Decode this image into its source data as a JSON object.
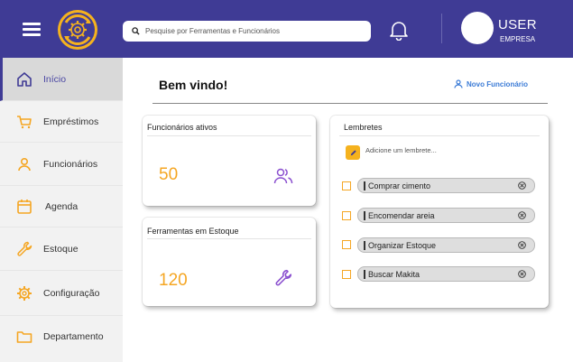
{
  "header": {
    "search": {
      "placeholder": "Pesquise por Ferramentas e Funcionários"
    },
    "user": {
      "name": "USER",
      "subtitle": "EMPRESA"
    },
    "icons": {
      "menu": "hamburger-icon",
      "logo": "gear-logo",
      "search": "search-icon",
      "notifications": "bell-icon"
    },
    "colors": {
      "header_bg": "#3f3b95",
      "accent": "#f5a623"
    }
  },
  "sidebar": {
    "items": [
      {
        "label": "Início",
        "icon": "home-icon",
        "active": true
      },
      {
        "label": "Empréstimos",
        "icon": "cart-icon",
        "active": false
      },
      {
        "label": "Funcionários",
        "icon": "user-icon",
        "active": false
      },
      {
        "label": "Agenda",
        "icon": "calendar-icon",
        "active": false
      },
      {
        "label": "Estoque",
        "icon": "wrench-icon",
        "active": false
      },
      {
        "label": "Configuração",
        "icon": "gear-icon",
        "active": false
      },
      {
        "label": "Departamento",
        "icon": "folder-icon",
        "active": false
      }
    ]
  },
  "main": {
    "welcome": "Bem vindo!",
    "new_employee_label": "Novo Funcionário",
    "cards": {
      "active_employees": {
        "title": "Funcionários ativos",
        "value": "50",
        "icon": "users-icon"
      },
      "tools_in_stock": {
        "title": "Ferramentas em Estoque",
        "value": "120",
        "icon": "wrench-icon"
      }
    },
    "reminders": {
      "title": "Lembretes",
      "input_placeholder": "Adicione um lembrete...",
      "items": [
        {
          "text": "Comprar cimento",
          "checked": false
        },
        {
          "text": "Encomendar areia",
          "checked": false
        },
        {
          "text": "Organizar Estoque",
          "checked": false
        },
        {
          "text": "Buscar Makita",
          "checked": false
        }
      ]
    }
  }
}
